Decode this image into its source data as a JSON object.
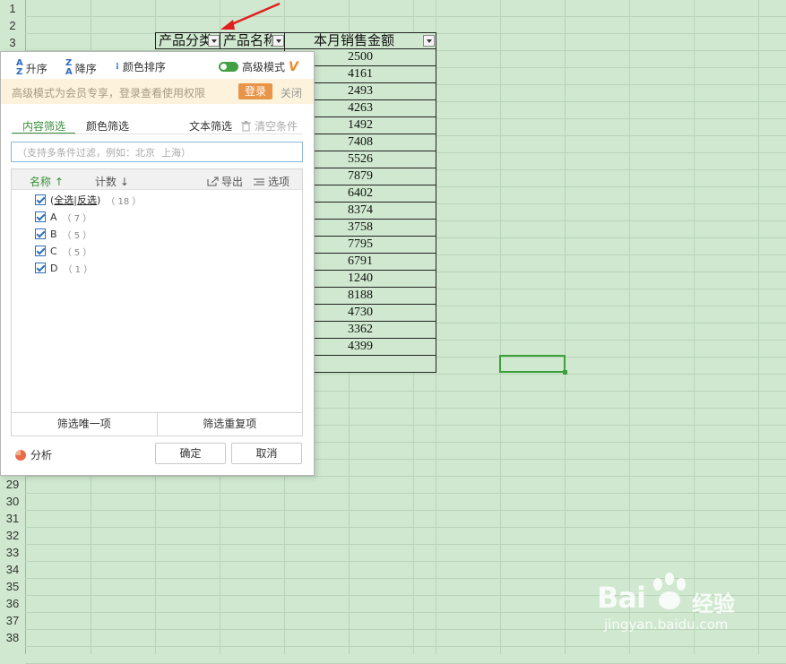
{
  "sheet": {
    "row_numbers_top": [
      "1",
      "2",
      "3"
    ],
    "row_numbers_bottom": [
      "29",
      "30",
      "31",
      "32",
      "33",
      "34",
      "35",
      "36",
      "37",
      "38"
    ],
    "headers": [
      "产品分类",
      "产品名称",
      "本月销售金额"
    ],
    "values": [
      "2500",
      "4161",
      "2493",
      "4263",
      "1492",
      "7408",
      "5526",
      "7879",
      "6402",
      "8374",
      "3758",
      "7795",
      "6791",
      "1240",
      "8188",
      "4730",
      "3362",
      "4399"
    ]
  },
  "panel": {
    "sort_asc": "升序",
    "sort_desc": "降序",
    "color_sort": "颜色排序",
    "advanced_mode": "高级模式",
    "vip_mark": "V",
    "banner_text": "高级模式为会员专享，登录查看使用权限",
    "login": "登录",
    "close": "关闭",
    "tab_content": "内容筛选",
    "tab_color": "颜色筛选",
    "text_filter": "文本筛选",
    "clear_conditions": "清空条件",
    "search_placeholder": "（支持多条件过滤，例如：北京  上海）",
    "col_name": "名称 ↑",
    "col_count": "计数 ↓",
    "export": "导出",
    "options": "选项",
    "select_all": "全选",
    "invert": "反选",
    "total_count": "（ 18 ）",
    "items": [
      {
        "label": "A",
        "count": "（ 7 ）"
      },
      {
        "label": "B",
        "count": "（ 5 ）"
      },
      {
        "label": "C",
        "count": "（ 5 ）"
      },
      {
        "label": "D",
        "count": "（ 1 ）"
      }
    ],
    "unique": "筛选唯一项",
    "duplicate": "筛选重复项",
    "analysis": "分析",
    "ok": "确定",
    "cancel": "取消"
  },
  "watermark": {
    "brand": "Bai",
    "brand_cn": "经验",
    "url": "jingyan.baidu.com"
  },
  "colors": {
    "sheet_bg": "#cfe8cf",
    "accent_green": "#3a8f3a",
    "login_orange": "#e8954a",
    "arrow_red": "#e02020"
  }
}
